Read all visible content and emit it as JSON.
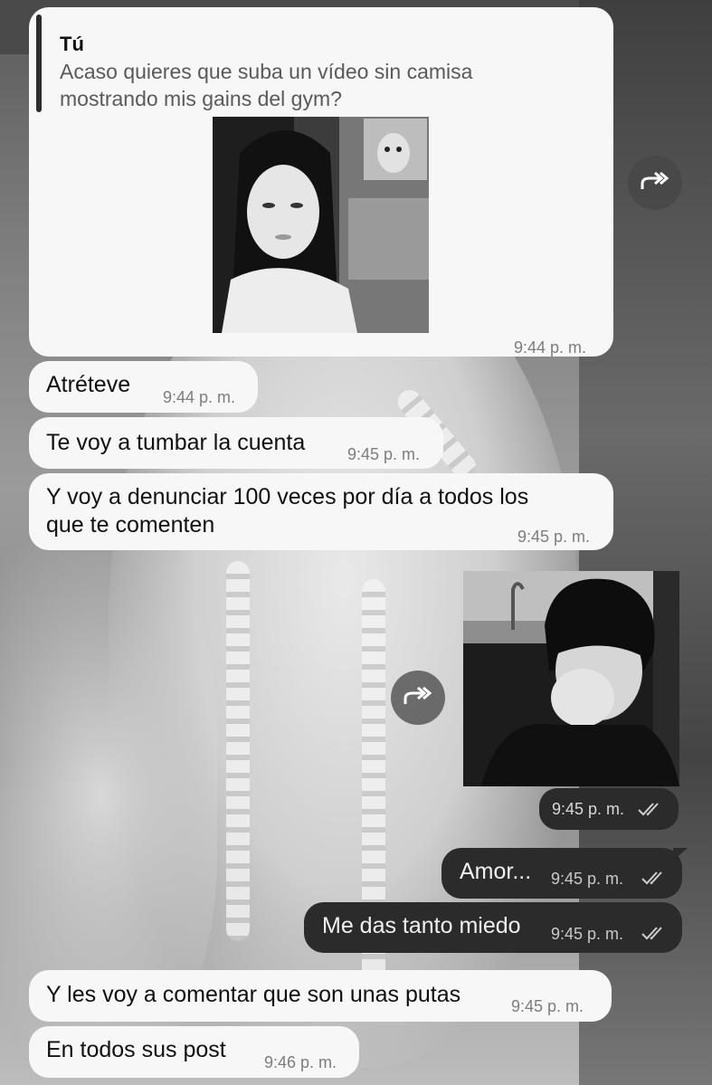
{
  "messages": [
    {
      "reply_to": {
        "name": "Tú",
        "text": "Acaso quieres que suba un vídeo sin camisa\nmostrando mis gains del gym?"
      },
      "time": "9:44 p. m."
    },
    {
      "text": "Atréteve",
      "time": "9:44 p. m."
    },
    {
      "text": "Te voy a tumbar la cuenta",
      "time": "9:45 p. m."
    },
    {
      "text": "Y voy a denunciar 100 veces por día a todos los",
      "text2": "que te comenten",
      "time": "9:45 p. m."
    },
    {
      "time": "9:45 p. m."
    },
    {
      "text": "Amor...",
      "time": "9:45 p. m."
    },
    {
      "text": "Me das tanto miedo",
      "time": "9:45 p. m."
    },
    {
      "text": "Y les voy a comentar que son unas putas",
      "time": "9:45 p. m."
    },
    {
      "text": "En todos sus post",
      "time": "9:46 p. m."
    }
  ],
  "icons": {
    "forward": "forward-icon",
    "read_receipt": "double-check-icon"
  },
  "colors": {
    "incoming_bubble": "#f7f7f7",
    "outgoing_bubble": "#2b2b2b",
    "quote_bar": "#2c2c2c"
  }
}
